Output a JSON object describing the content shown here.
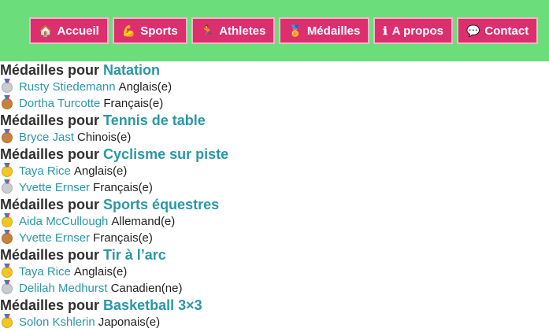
{
  "nav": {
    "items": [
      {
        "label": "Accueil",
        "icon": "home-icon",
        "glyph": "🏠"
      },
      {
        "label": "Sports",
        "icon": "muscle-icon",
        "glyph": "💪"
      },
      {
        "label": "Athletes",
        "icon": "runner-icon",
        "glyph": "🏃"
      },
      {
        "label": "Médailles",
        "icon": "medal-icon",
        "glyph": "🏅"
      },
      {
        "label": "A propos",
        "icon": "info-icon",
        "glyph": "ℹ"
      },
      {
        "label": "Contact",
        "icon": "speech-bubble-icon",
        "glyph": "💬"
      }
    ]
  },
  "colors": {
    "navbar_bg": "#6bde7b",
    "button_bg": "#dc2f6e",
    "link": "#2a97a6",
    "gold": "#f3c623",
    "silver": "#c9cdd2",
    "bronze": "#c9823e"
  },
  "heading_prefix": "Médailles pour",
  "sections": [
    {
      "sport": "Natation",
      "medals": [
        {
          "medal": "silver",
          "athlete": "Rusty Stiedemann",
          "nationality": "Anglais(e)"
        },
        {
          "medal": "bronze",
          "athlete": "Dortha Turcotte",
          "nationality": "Français(e)"
        }
      ]
    },
    {
      "sport": "Tennis de table",
      "medals": [
        {
          "medal": "bronze",
          "athlete": "Bryce Jast",
          "nationality": "Chinois(e)"
        }
      ]
    },
    {
      "sport": "Cyclisme sur piste",
      "medals": [
        {
          "medal": "gold",
          "athlete": "Taya Rice",
          "nationality": "Anglais(e)"
        },
        {
          "medal": "silver",
          "athlete": "Yvette Ernser",
          "nationality": "Français(e)"
        }
      ]
    },
    {
      "sport": "Sports équestres",
      "medals": [
        {
          "medal": "gold",
          "athlete": "Aida McCullough",
          "nationality": "Allemand(e)"
        },
        {
          "medal": "bronze",
          "athlete": "Yvette Ernser",
          "nationality": "Français(e)"
        }
      ]
    },
    {
      "sport": "Tir à l’arc",
      "medals": [
        {
          "medal": "gold",
          "athlete": "Taya Rice",
          "nationality": "Anglais(e)"
        },
        {
          "medal": "silver",
          "athlete": "Delilah Medhurst",
          "nationality": "Canadien(ne)"
        }
      ]
    },
    {
      "sport": "Basketball 3×3",
      "medals": [
        {
          "medal": "gold",
          "athlete": "Solon Kshlerin",
          "nationality": "Japonais(e)"
        }
      ]
    }
  ]
}
